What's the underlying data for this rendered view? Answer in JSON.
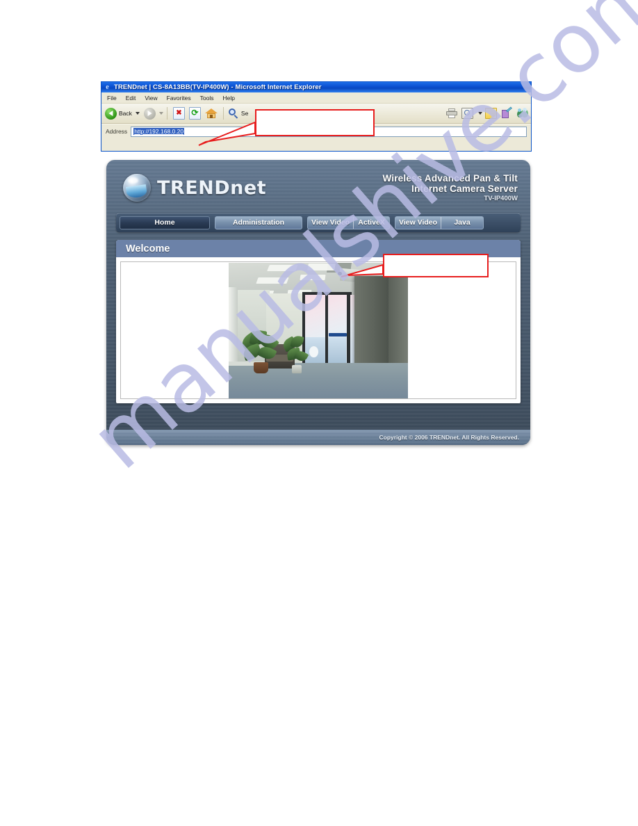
{
  "browser": {
    "title": "TRENDnet | CS-8A13BB(TV-IP400W) - Microsoft Internet Explorer",
    "icon": "ie-icon",
    "menu": [
      "File",
      "Edit",
      "View",
      "Favorites",
      "Tools",
      "Help"
    ],
    "toolbar": {
      "back_label": "Back",
      "forward_label": "",
      "search_label": "Se",
      "icons": [
        "back-icon",
        "forward-icon",
        "stop-icon",
        "refresh-icon",
        "home-icon",
        "search-icon",
        "print-icon",
        "history-icon",
        "mail-icon",
        "edit-icon",
        "messenger-icon"
      ]
    },
    "address": {
      "label": "Address",
      "value": "http://192.168.0.20",
      "placeholder": "http://"
    }
  },
  "callouts": [
    {
      "name": "callout-address",
      "text": ""
    },
    {
      "name": "callout-welcome",
      "text": ""
    }
  ],
  "page": {
    "brand": "TRENDnet",
    "product_line1": "Wireless Advanced Pan & Tilt",
    "product_line2": "Internet Camera Server",
    "model": "TV-IP400W",
    "nav": [
      {
        "label": "Home",
        "active": true,
        "split": false
      },
      {
        "label": "Administration",
        "active": false,
        "split": false
      },
      {
        "label_a": "View Video",
        "label_b": "ActiveX",
        "active": false,
        "split": true
      },
      {
        "label_a": "View Video",
        "label_b": "Java",
        "active": false,
        "split": true
      }
    ],
    "section_title": "Welcome",
    "video": {
      "name": "live-video-feed",
      "alt": "Office lobby live camera view"
    },
    "footer": "Copyright © 2006 TRENDnet. All Rights Reserved."
  },
  "watermark": {
    "text": "manualshive.com"
  },
  "colors": {
    "titlebar": "#0a4fd0",
    "chrome": "#ece9d8",
    "panel_dark": "#3a4c60",
    "welcome_bar": "#6c82a8",
    "callout_red": "#e71d1d",
    "nav_active": "#2a3b54",
    "watermark": "#b9bce4"
  }
}
